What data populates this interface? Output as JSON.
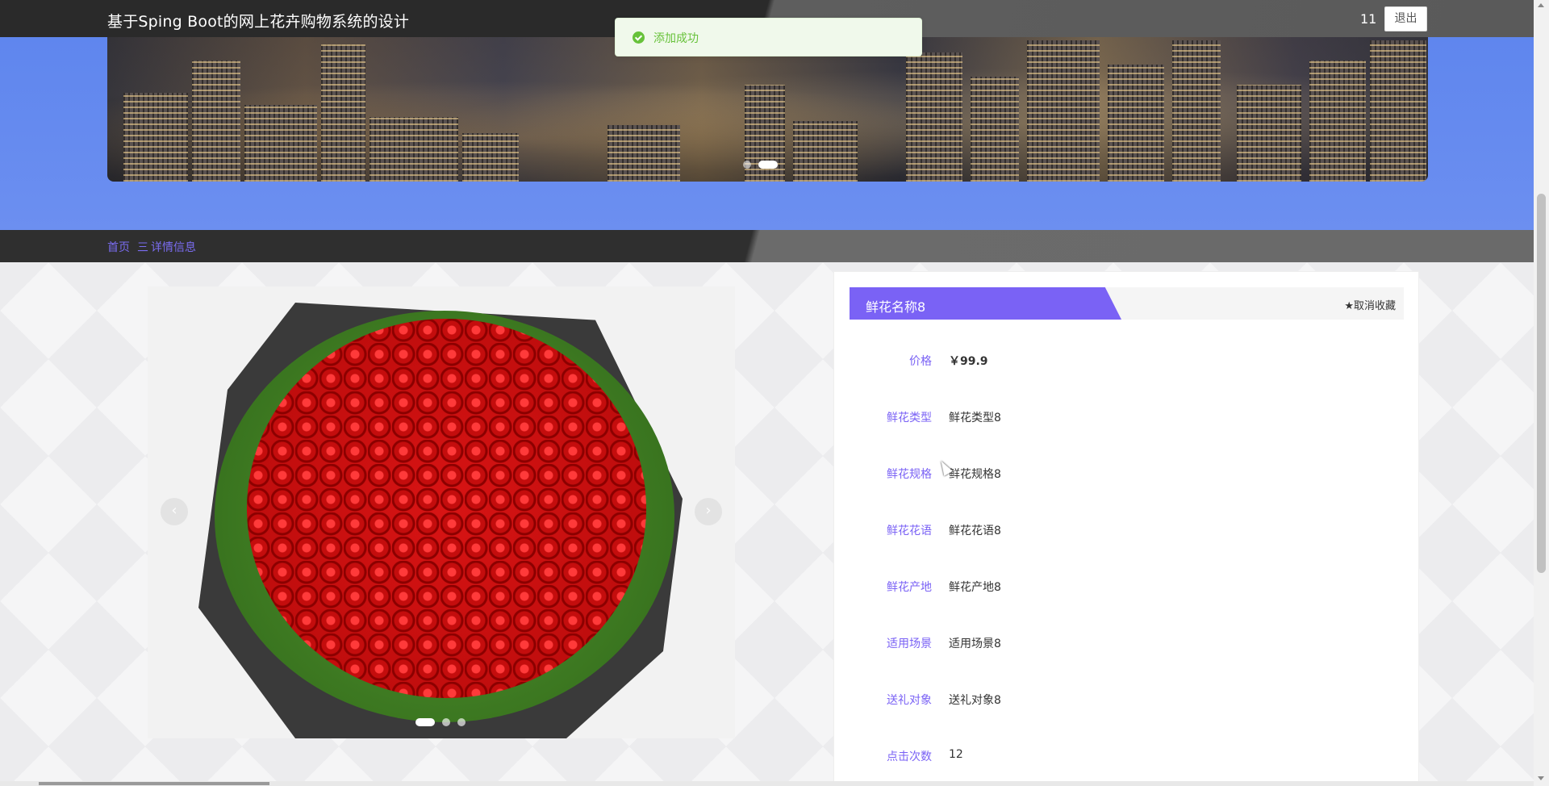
{
  "header": {
    "site_title": "基于Sping Boot的网上花卉购物系统的设计",
    "user_name": "11",
    "logout_label": "退出"
  },
  "toast": {
    "message": "添加成功",
    "type": "success",
    "color": "#67c23a"
  },
  "breadcrumb": {
    "home": "首页",
    "separator": "三",
    "current": "详情信息"
  },
  "product": {
    "name": "鲜花名称8",
    "favorite_label": "★取消收藏",
    "fields": [
      {
        "label": "价格",
        "value": "￥99.9"
      },
      {
        "label": "鲜花类型",
        "value": "鲜花类型8"
      },
      {
        "label": "鲜花规格",
        "value": "鲜花规格8"
      },
      {
        "label": "鲜花花语",
        "value": "鲜花花语8"
      },
      {
        "label": "鲜花产地",
        "value": "鲜花产地8"
      },
      {
        "label": "适用场景",
        "value": "适用场景8"
      },
      {
        "label": "送礼对象",
        "value": "送礼对象8"
      },
      {
        "label": "点击次数",
        "value": "12"
      }
    ]
  },
  "gallery": {
    "prev_icon": "chevron-left-icon",
    "next_icon": "chevron-right-icon",
    "prev_glyph": "‹",
    "next_glyph": "›"
  },
  "colors": {
    "accent": "#7a62f5",
    "banner_blue": "#6a8df0",
    "topbar_dark": "#2a2a2a"
  }
}
